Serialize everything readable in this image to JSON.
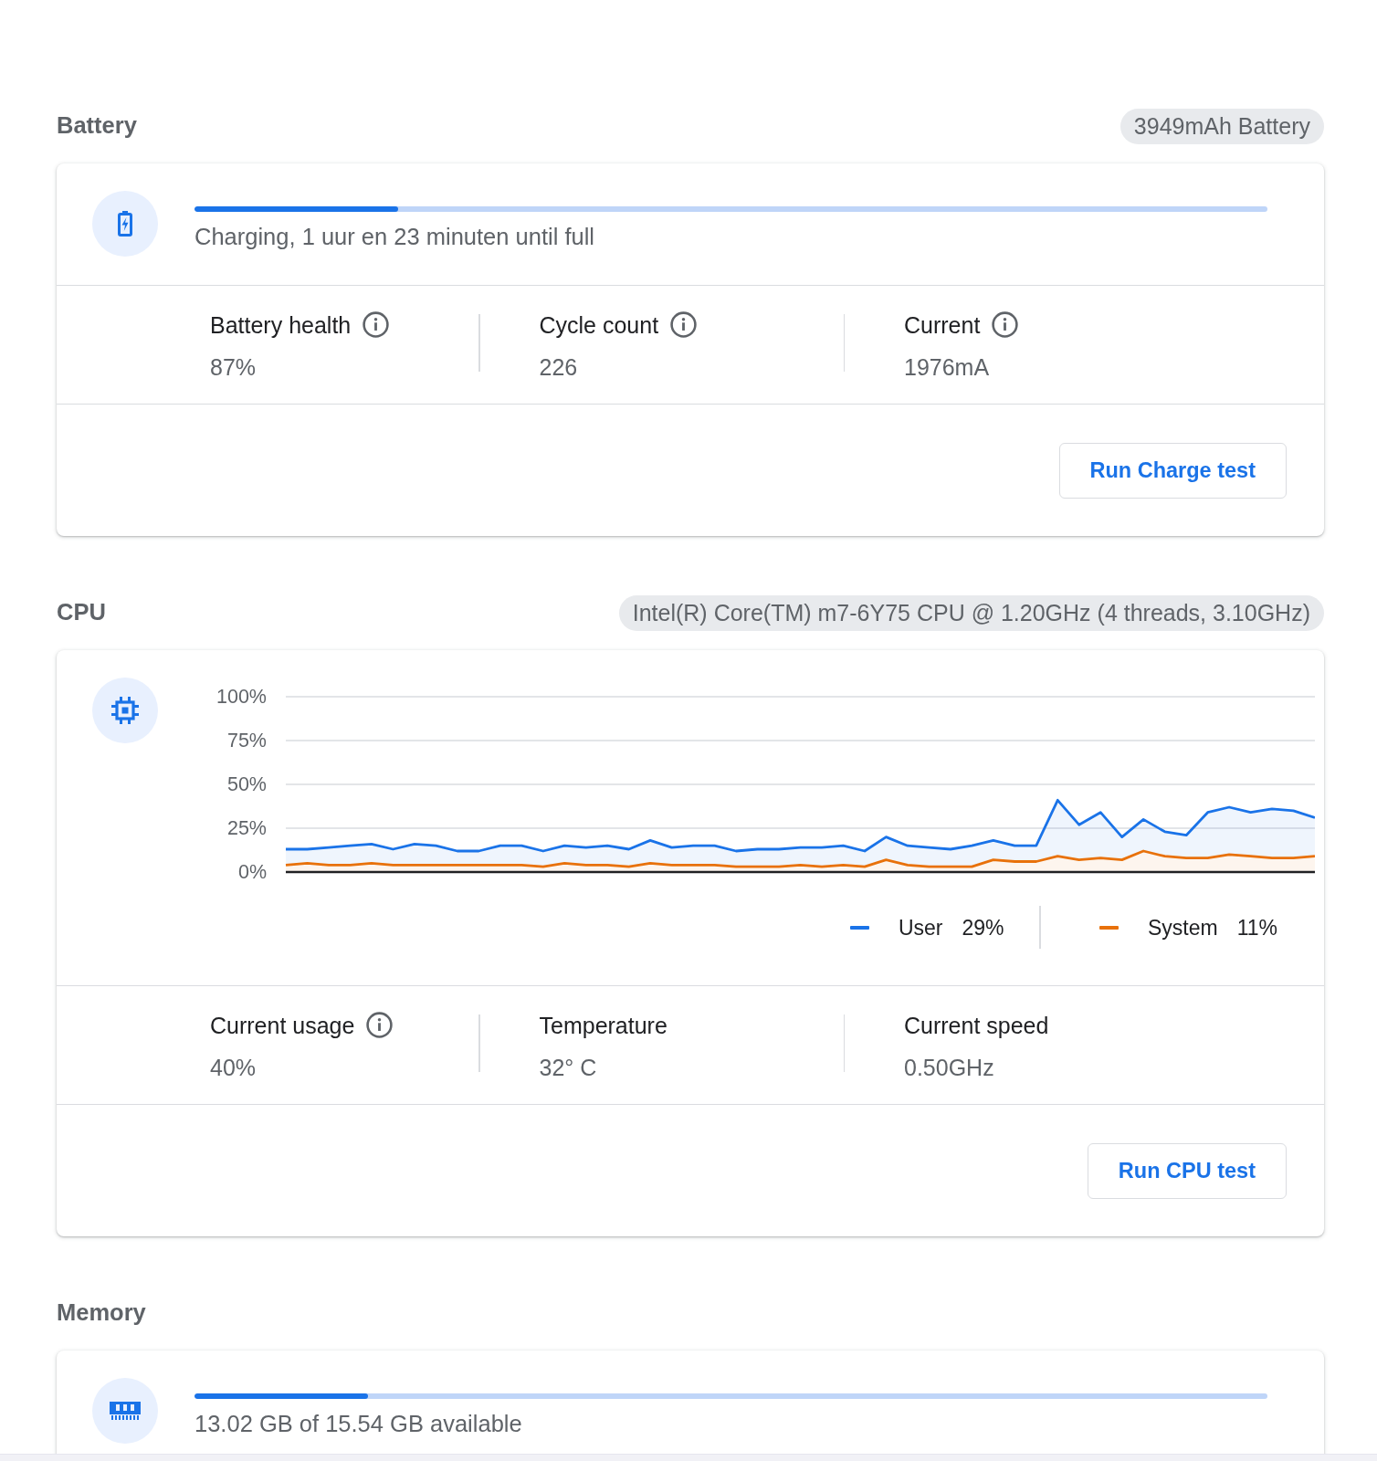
{
  "sections": [
    {
      "kind": "battery",
      "title": "Battery",
      "chip": "3949mAh Battery",
      "progress": {
        "level": 0.19,
        "label": "Charging, 1 uur en 23 minuten until full"
      },
      "stats": [
        {
          "label": "Battery health",
          "info": true,
          "value": "87%"
        },
        {
          "label": "Cycle count",
          "info": true,
          "value": "226"
        },
        {
          "label": "Current",
          "info": true,
          "value": "1976mA"
        }
      ],
      "button": "Run Charge test"
    },
    {
      "kind": "cpu",
      "title": "CPU",
      "chip": "Intel(R) Core(TM) m7-6Y75 CPU @ 1.20GHz (4 threads, 3.10GHz)",
      "chart_data": {
        "type": "line",
        "grid": true,
        "ylim": [
          0,
          100
        ],
        "yticks": [
          {
            "value": 100,
            "label": "100%"
          },
          {
            "value": 75,
            "label": "75%"
          },
          {
            "value": 50,
            "label": "50%"
          },
          {
            "value": 25,
            "label": "25%"
          },
          {
            "value": 0,
            "label": "0%"
          }
        ],
        "series": [
          {
            "name": "User",
            "color": "#1a73e8",
            "values": [
              13,
              13,
              14,
              15,
              16,
              13,
              16,
              15,
              12,
              12,
              15,
              15,
              12,
              15,
              14,
              15,
              13,
              18,
              14,
              15,
              15,
              12,
              13,
              13,
              14,
              14,
              15,
              12,
              20,
              15,
              14,
              13,
              15,
              18,
              15,
              15,
              41,
              27,
              34,
              20,
              30,
              23,
              21,
              34,
              37,
              34,
              36,
              35,
              31
            ]
          },
          {
            "name": "System",
            "color": "#e8710a",
            "values": [
              4,
              5,
              4,
              4,
              5,
              4,
              4,
              4,
              4,
              4,
              4,
              4,
              3,
              5,
              4,
              4,
              3,
              5,
              4,
              4,
              4,
              3,
              3,
              3,
              4,
              3,
              4,
              3,
              7,
              4,
              3,
              3,
              3,
              7,
              6,
              6,
              9,
              7,
              8,
              7,
              12,
              9,
              8,
              8,
              10,
              9,
              8,
              8,
              9
            ]
          }
        ]
      },
      "legend_readings": [
        "29%",
        "11%"
      ],
      "stats": [
        {
          "label": "Current usage",
          "info": true,
          "value": "40%"
        },
        {
          "label": "Temperature",
          "info": false,
          "value": "32° C"
        },
        {
          "label": "Current speed",
          "info": false,
          "value": "0.50GHz"
        }
      ],
      "button": "Run CPU test"
    },
    {
      "kind": "memory",
      "title": "Memory",
      "progress": {
        "level": 0.162,
        "label": "13.02 GB of 15.54 GB available"
      }
    }
  ]
}
